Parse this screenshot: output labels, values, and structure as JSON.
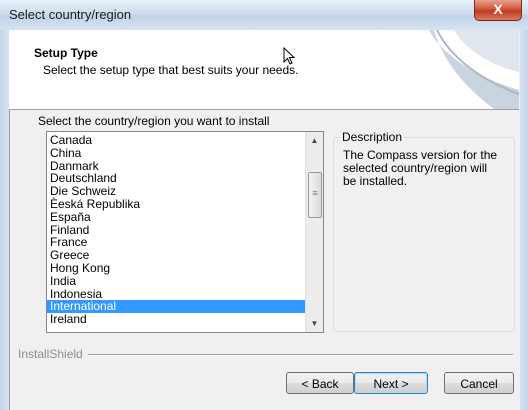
{
  "window": {
    "title": "Select country/region",
    "close_symbol": "X"
  },
  "header": {
    "title": "Setup Type",
    "subtitle": "Select the setup type that best suits your needs."
  },
  "section_label": "Select the country/region you want to install",
  "list": {
    "items": [
      "Canada",
      "China",
      "Danmark",
      "Deutschland",
      "Die Schweiz",
      "Èeská Republika",
      "España",
      "Finland",
      "France",
      "Greece",
      "Hong Kong",
      "India",
      "Indonesia",
      "International",
      "Ireland"
    ],
    "selected": "International"
  },
  "description": {
    "legend": "Description",
    "text": "The Compass version for the selected country/region will  be installed."
  },
  "installshield_label": "InstallShield",
  "buttons": {
    "back": "< Back",
    "next": "Next >",
    "cancel": "Cancel"
  },
  "colors": {
    "selection": "#3399ff",
    "close_button": "#c7432a"
  }
}
